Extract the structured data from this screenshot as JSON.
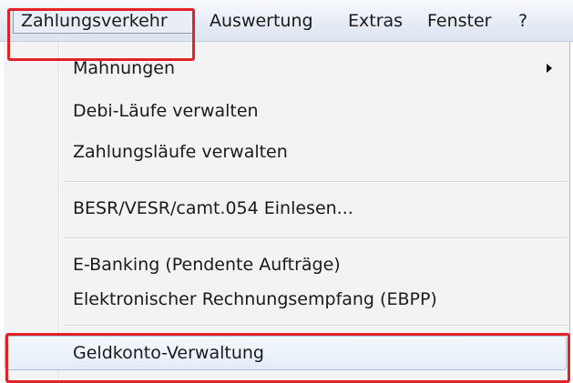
{
  "menubar": {
    "items": [
      {
        "label": "Zahlungsverkehr"
      },
      {
        "label": "Auswertung"
      },
      {
        "label": "Extras"
      },
      {
        "label": "Fenster"
      },
      {
        "label": "?"
      }
    ]
  },
  "dropdown": {
    "items": [
      {
        "label": "Mahnungen",
        "has_submenu": true
      },
      {
        "label": "Debi-Läufe verwalten"
      },
      {
        "label": "Zahlungsläufe verwalten"
      },
      {
        "label": "BESR/VESR/camt.054 Einlesen..."
      },
      {
        "label": "E-Banking (Pendente Aufträge)"
      },
      {
        "label": "Elektronischer Rechnungsempfang (EBPP)"
      },
      {
        "label": "Geldkonto-Verwaltung"
      }
    ]
  },
  "colors": {
    "highlight_annotation": "#e32227",
    "menubar_bg": "#e6ecf5",
    "dropdown_bg": "#f3f3f3",
    "hover_border": "#a8c1e3"
  }
}
